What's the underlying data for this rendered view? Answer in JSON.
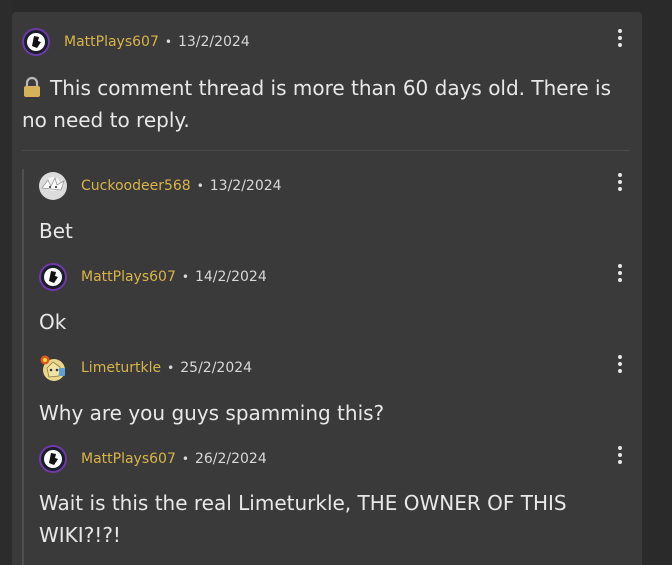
{
  "comments": [
    {
      "author": "MattPlays607",
      "separator": "•",
      "date": "13/2/2024",
      "text": "This comment thread is more than 60 days old. There is no need to reply.",
      "avatar": "mattplays-avatar-icon"
    },
    {
      "author": "Cuckoodeer568",
      "separator": "•",
      "date": "13/2/2024",
      "text": "Bet",
      "avatar": "cuckoodeer-avatar-icon"
    },
    {
      "author": "MattPlays607",
      "separator": "•",
      "date": "14/2/2024",
      "text": "Ok",
      "avatar": "mattplays-avatar-icon"
    },
    {
      "author": "Limeturtkle",
      "separator": "•",
      "date": "25/2/2024",
      "text": "Why are you guys spamming this?",
      "avatar": "limeturtkle-avatar-icon"
    },
    {
      "author": "MattPlays607",
      "separator": "•",
      "date": "26/2/2024",
      "text": "Wait is this the real Limeturkle, THE OWNER OF THIS WIKI?!?!",
      "avatar": "mattplays-avatar-icon"
    }
  ],
  "colors": {
    "background": "#2a2a2a",
    "panel": "#3a3a3a",
    "author": "#d9b44a",
    "text": "#e8e8e8"
  },
  "icons": {
    "lock": "lock-icon",
    "menu": "kebab-menu-icon"
  }
}
